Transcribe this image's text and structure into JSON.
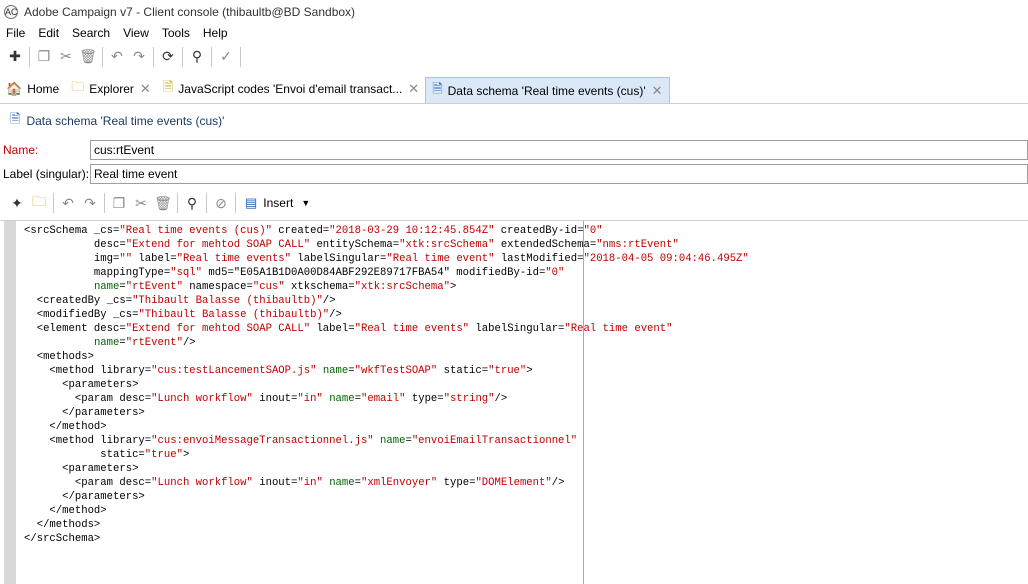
{
  "window": {
    "icon_text": "AC",
    "title": "Adobe Campaign v7 - Client console (thibaultb@BD Sandbox)"
  },
  "menu": [
    "File",
    "Edit",
    "Search",
    "View",
    "Tools",
    "Help"
  ],
  "toolbar_icons": [
    "new-icon",
    "copy-icon",
    "cut-icon",
    "delete-icon",
    "undo-icon",
    "redo-icon",
    "refresh-icon",
    "find-icon",
    "save-icon"
  ],
  "tabs": [
    {
      "label": "Home",
      "icon": "home-icon"
    },
    {
      "label": "Explorer",
      "icon": "folder-icon"
    },
    {
      "label": "JavaScript codes 'Envoi d'email transact...",
      "icon": "javascript-icon"
    },
    {
      "label": "Data schema 'Real time events (cus)'",
      "icon": "schema-icon"
    }
  ],
  "document": {
    "header": "Data schema 'Real time events (cus)'",
    "name_label": "Name:",
    "name_value": "cus:rtEvent",
    "label_label": "Label (singular):",
    "label_value": "Real time event"
  },
  "editor_toolbar": {
    "insert_label": "Insert"
  },
  "code_lines": [
    "<srcSchema _cs=\"Real time events (cus)\" created=\"2018-03-29 10:12:45.854Z\" createdBy-id=\"0\"",
    "           desc=\"Extend for mehtod SOAP CALL\" entitySchema=\"xtk:srcSchema\" extendedSchema=\"nms:rtEvent\"",
    "           img=\"\" label=\"Real time events\" labelSingular=\"Real time event\" lastModified=\"2018-04-05 09:04:46.495Z\"",
    "           mappingType=\"sql\" md5=\"E05A1B1D0A00D84ABF292E89717FBA54\" modifiedBy-id=\"0\"",
    "           name=\"rtEvent\" namespace=\"cus\" xtkschema=\"xtk:srcSchema\">",
    "  <createdBy _cs=\"Thibault Balasse (thibaultb)\"/>",
    "  <modifiedBy _cs=\"Thibault Balasse (thibaultb)\"/>",
    "  <element desc=\"Extend for mehtod SOAP CALL\" label=\"Real time events\" labelSingular=\"Real time event\"",
    "           name=\"rtEvent\"/>",
    "  <methods>",
    "    <method library=\"cus:testLancementSAOP.js\" name=\"wkfTestSOAP\" static=\"true\">",
    "      <parameters>",
    "        <param desc=\"Lunch workflow\" inout=\"in\" name=\"email\" type=\"string\"/>",
    "      </parameters>",
    "    </method>",
    "    <method library=\"cus:envoiMessageTransactionnel.js\" name=\"envoiEmailTransactionnel\"",
    "            static=\"true\">",
    "      <parameters>",
    "        <param desc=\"Lunch workflow\" inout=\"in\" name=\"xmlEnvoyer\" type=\"DOMElement\"/>",
    "      </parameters>",
    "    </method>",
    "  </methods>",
    "</srcSchema>"
  ],
  "colors": {
    "string": "#c00000",
    "attribute_name": "#006400",
    "active_tab": "#dbe8f7",
    "required_label": "#c00000"
  }
}
